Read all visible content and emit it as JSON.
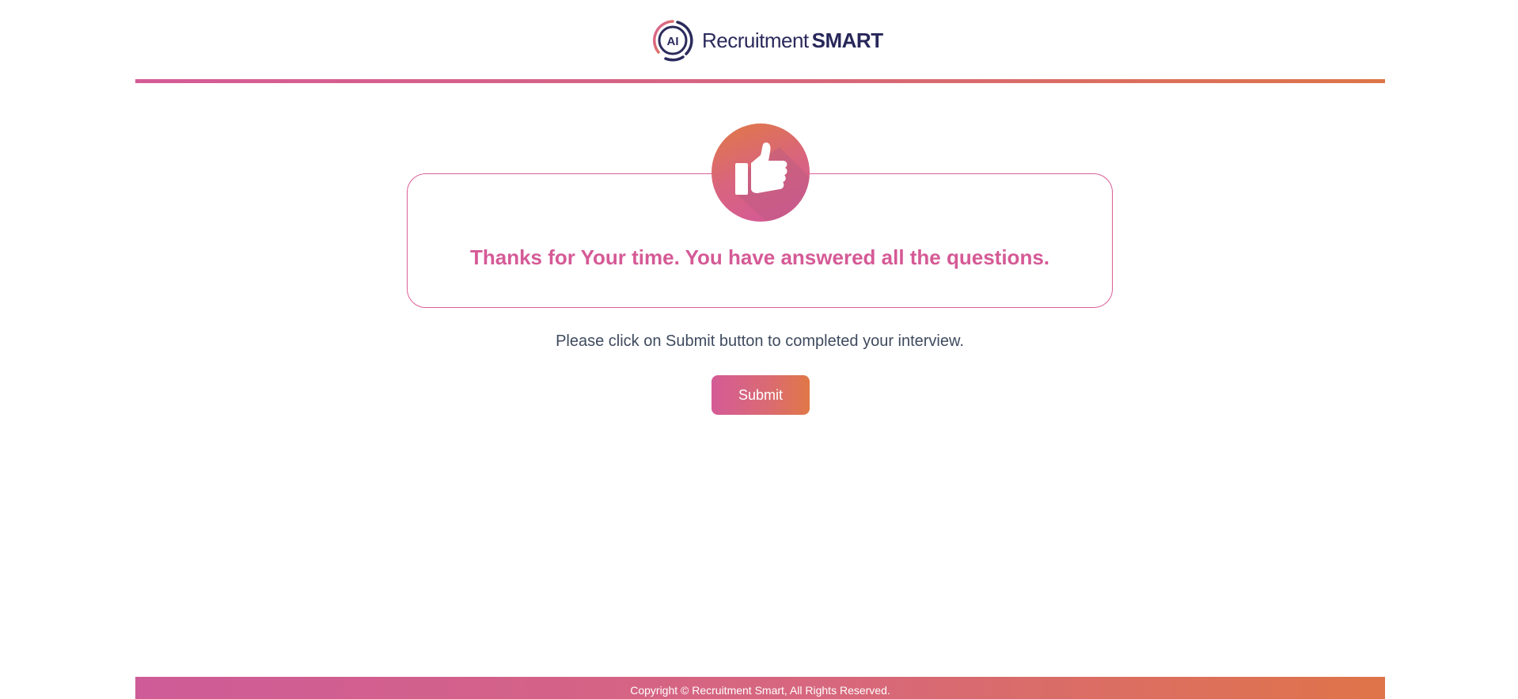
{
  "header": {
    "logo_mark": "AI",
    "logo_text_light": "Recruitment",
    "logo_text_bold": "SMART"
  },
  "main": {
    "icon": "thumbs-up-icon",
    "title": "Thanks for Your time. You have answered all the questions.",
    "instruction": "Please click on Submit button to completed your interview.",
    "submit_label": "Submit"
  },
  "footer": {
    "copyright": "Copyright © Recruitment Smart, All Rights Reserved."
  },
  "colors": {
    "accent_pink": "#d55a96",
    "accent_orange": "#e07847",
    "navy": "#2b2a5c",
    "body_text": "#3e4a5e"
  }
}
